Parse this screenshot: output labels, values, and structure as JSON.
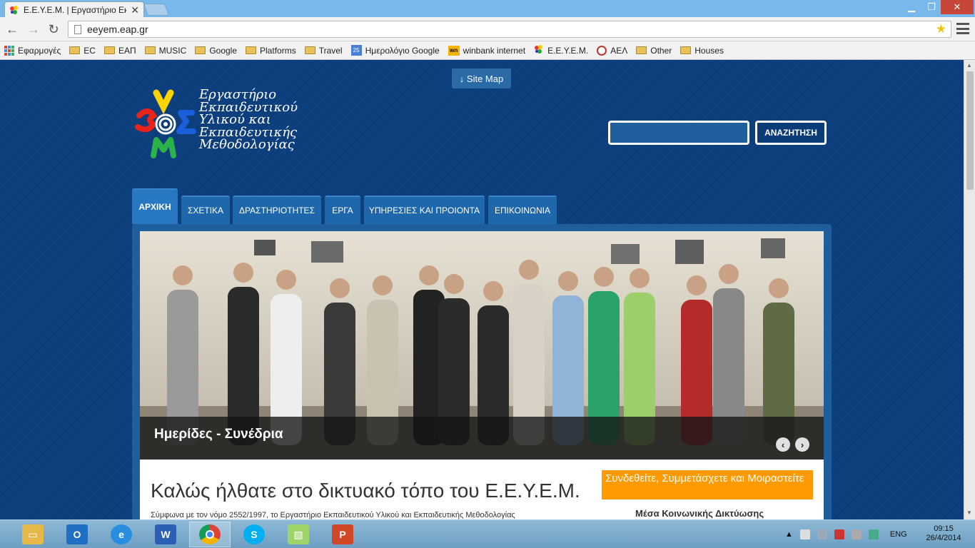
{
  "browser": {
    "tab_title": "Ε.Ε.Υ.Ε.Μ. | Εργαστήριο Εκ",
    "url": "eeyem.eap.gr",
    "bookmarks": [
      {
        "label": "Εφαρμογές",
        "icon": "apps-icon"
      },
      {
        "label": "EC",
        "icon": "folder-icon"
      },
      {
        "label": "ΕΑΠ",
        "icon": "folder-icon"
      },
      {
        "label": "MUSIC",
        "icon": "folder-icon"
      },
      {
        "label": "Google",
        "icon": "folder-icon"
      },
      {
        "label": "Platforms",
        "icon": "folder-icon"
      },
      {
        "label": "Travel",
        "icon": "folder-icon"
      },
      {
        "label": "Ημερολόγιο Google",
        "icon": "calendar-icon"
      },
      {
        "label": "winbank internet",
        "icon": "winbank-icon"
      },
      {
        "label": "Ε.Ε.Υ.Ε.Μ.",
        "icon": "eeyem-icon"
      },
      {
        "label": "ΑΕΛ",
        "icon": "ael-icon"
      },
      {
        "label": "Other",
        "icon": "folder-icon"
      },
      {
        "label": "Houses",
        "icon": "folder-icon"
      }
    ],
    "calendar_icon_text": "25",
    "winbank_icon_text": "wn"
  },
  "page": {
    "sitemap_label": "↓ Site Map",
    "logo_lines": [
      "Εργαστήριο",
      "Εκπαιδευτικού",
      "Υλικού και",
      "Εκπαιδευτικής",
      "Μεθοδολογίας"
    ],
    "search": {
      "value": "",
      "button": "ΑΝΑΖΗΤΗΣΗ"
    },
    "nav": [
      "ΑΡΧΙΚΗ",
      "ΣΧΕΤΙΚΑ",
      "ΔΡΑΣΤΗΡΙΟΤΗΤΕΣ",
      "ΕΡΓΑ",
      "ΥΠΗΡΕΣΙΕΣ ΚΑΙ ΠΡΟΙΟΝΤΑ",
      "ΕΠΙΚΟΙΝΩΝΙΑ"
    ],
    "slider": {
      "caption": "Ημερίδες - Συνέδρια",
      "prev": "‹",
      "next": "›"
    },
    "welcome": "Καλώς ήλθατε στο δικτυακό τόπο του Ε.Ε.Υ.Ε.Μ.",
    "intro": "Σύμφωνα με τον νόμο 2552/1997, το Εργαστήριο Εκπαιδευτικού Υλικού και Εκπαιδευτικής Μεθοδολογίας",
    "social_box": "Συνδεθείτε, Συμμετάσχετε και Μοιραστείτε",
    "social_title": "Μέσα Κοινωνικής Δικτύωσης"
  },
  "taskbar": {
    "apps": [
      "file-explorer-icon",
      "outlook-icon",
      "internet-explorer-icon",
      "word-icon",
      "chrome-icon",
      "skype-icon",
      "photos-icon",
      "powerpoint-icon"
    ],
    "language": "ENG",
    "time": "09:15",
    "date": "26/4/2014"
  },
  "colors": {
    "page_bg": "#0c3c78",
    "nav_tab": "#1f67ab",
    "social_box": "#ff9b00",
    "chrome_frame": "#6fb0e3"
  }
}
